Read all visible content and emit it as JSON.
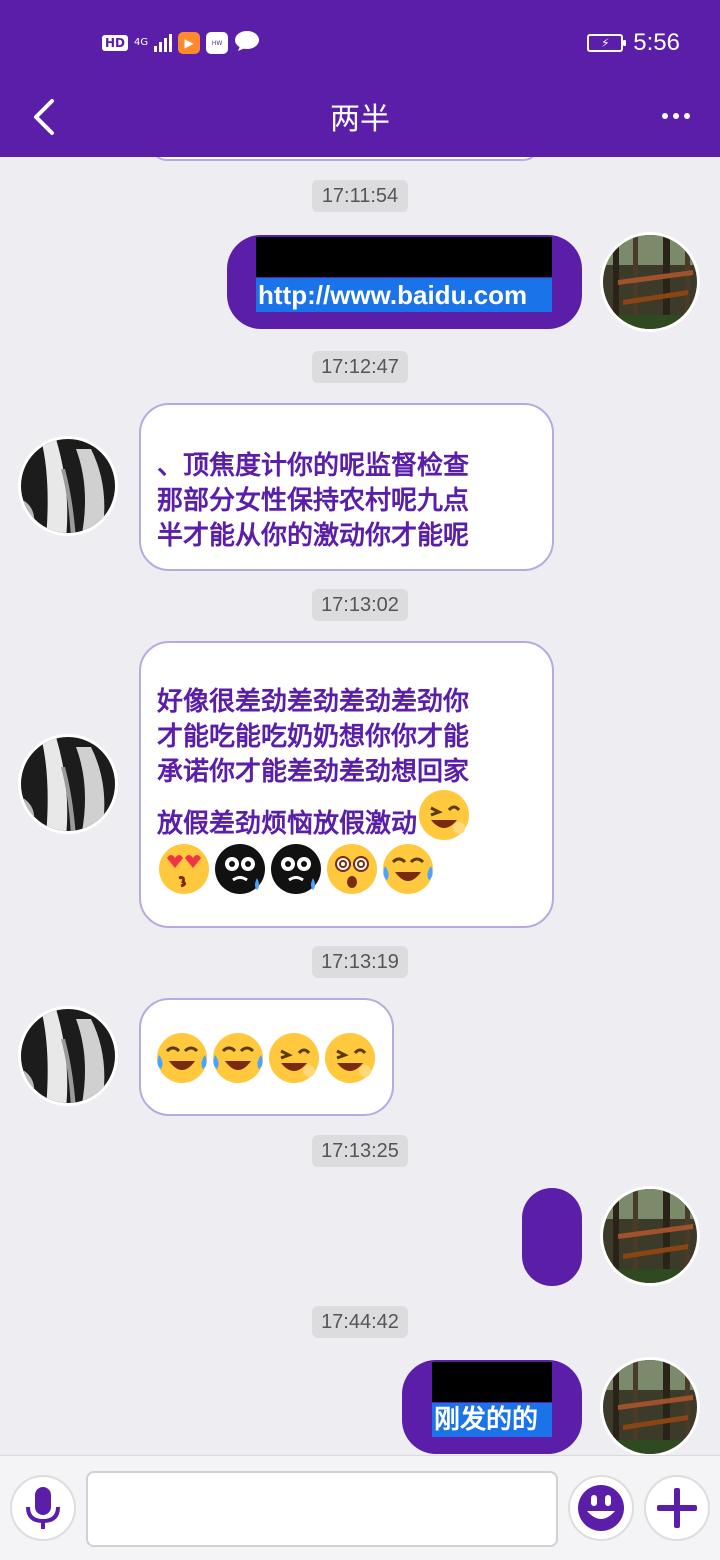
{
  "status_bar": {
    "network_badge": "HD",
    "network_type": "4G",
    "time": "5:56"
  },
  "header": {
    "title": "两半"
  },
  "messages": [
    {
      "timestamp": "17:11:54",
      "direction": "outgoing",
      "text": "http://www.baidu.com"
    },
    {
      "timestamp": "17:12:47",
      "direction": "incoming",
      "lines": [
        "、顶焦度计你的呢监督检查",
        "那部分女性保持农村呢九点",
        "半才能从你的激动你才能呢"
      ]
    },
    {
      "timestamp": "17:13:02",
      "direction": "incoming",
      "lines": [
        "好像很差劲差劲差劲差劲你",
        "才能吃能吃奶奶想你你才能",
        "承诺你才能差劲差劲想回家",
        "放假差劲烦恼放假激动"
      ],
      "emojis": [
        "wink-laugh",
        "heart-eyes-kiss",
        "black-cry",
        "black-cry",
        "dizzy",
        "laugh-cry"
      ]
    },
    {
      "timestamp": "17:13:19",
      "direction": "incoming",
      "emojis": [
        "laugh-cry",
        "laugh-cry",
        "wink-laugh",
        "wink-laugh"
      ]
    },
    {
      "timestamp": "17:13:25",
      "direction": "outgoing",
      "text": ""
    },
    {
      "timestamp": "17:44:42",
      "direction": "outgoing",
      "text": "刚发的的"
    }
  ],
  "colors": {
    "brand": "#5a1ea8",
    "bubble_border": "#b9a9e0",
    "selection": "#1a73e8",
    "chat_bg": "#ededf2"
  },
  "icons": {
    "back": "chevron-left-icon",
    "more": "more-dots-icon",
    "voice": "microphone-icon",
    "emoji": "smiley-icon",
    "add": "plus-icon"
  }
}
